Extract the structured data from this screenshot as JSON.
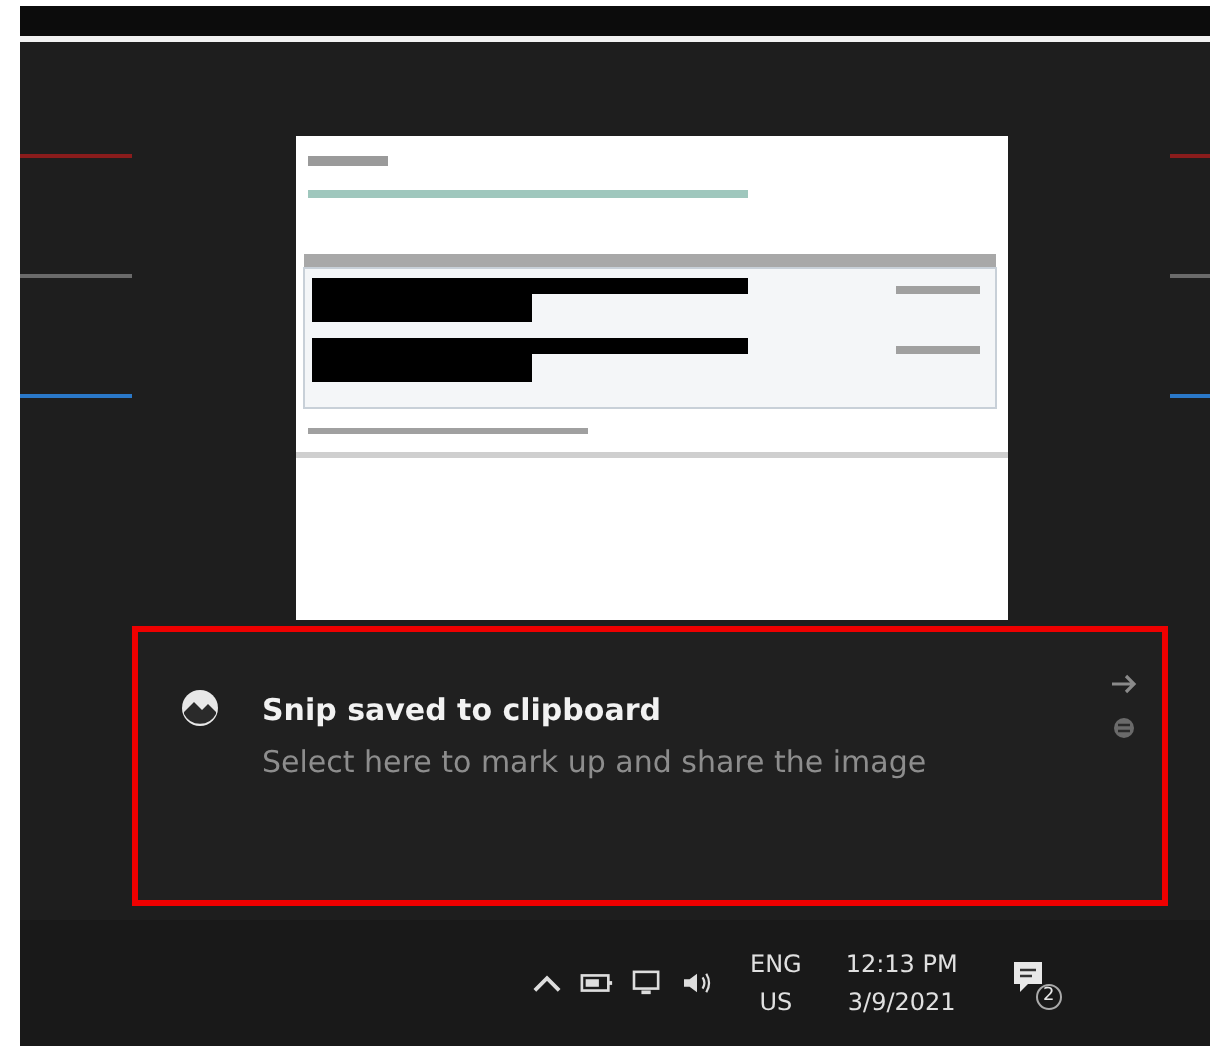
{
  "toast": {
    "title": "Snip saved to clipboard",
    "body": "Select here to mark up and share the image"
  },
  "taskbar": {
    "language": [
      "ENG",
      "US"
    ],
    "time": "12:13 PM",
    "date": "3/9/2021",
    "notification_count": "2"
  }
}
